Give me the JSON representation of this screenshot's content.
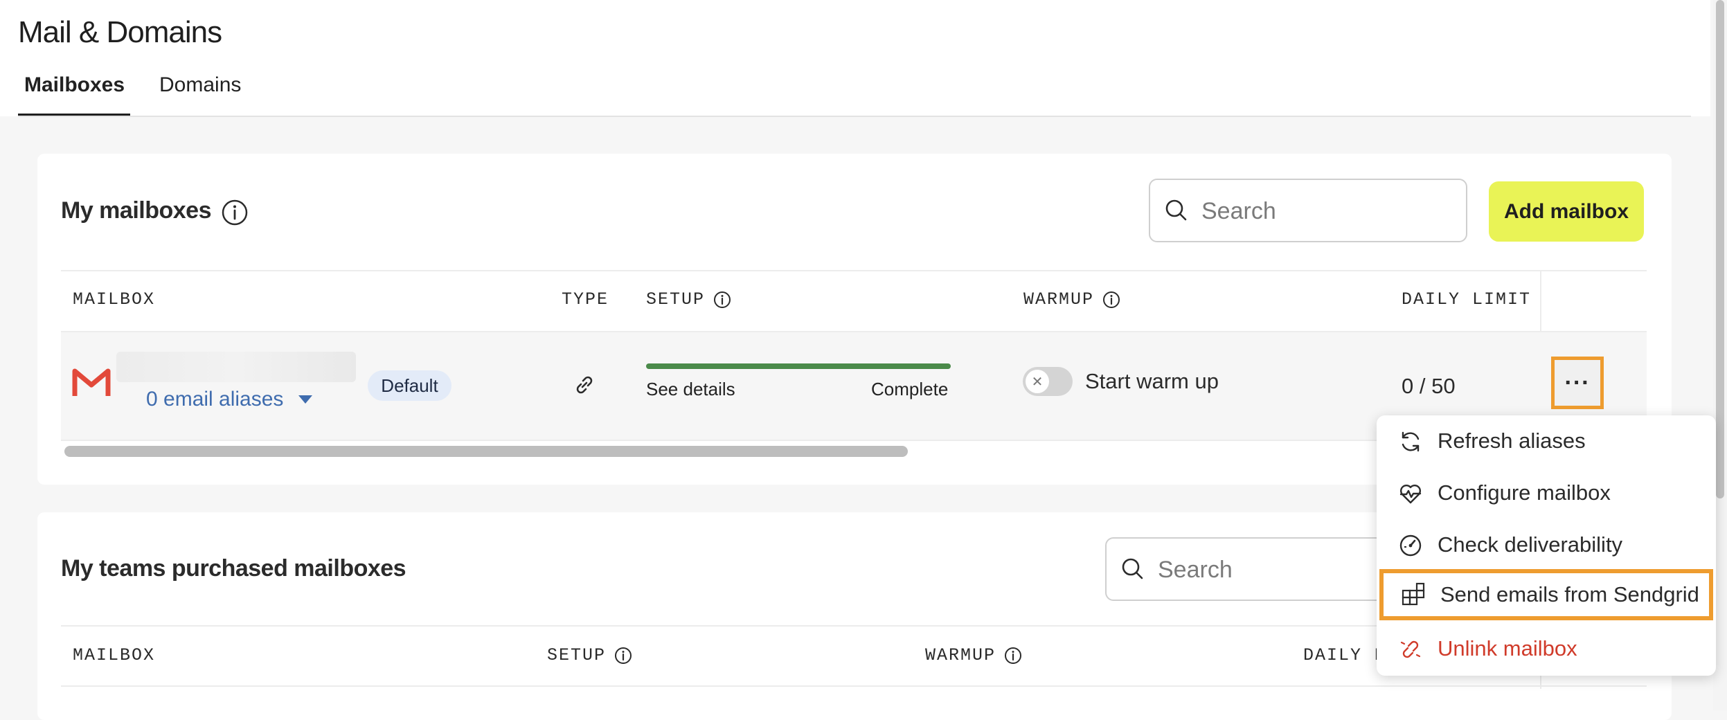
{
  "header": {
    "title": "Mail & Domains",
    "tabs": [
      {
        "label": "Mailboxes",
        "active": true
      },
      {
        "label": "Domains",
        "active": false
      }
    ]
  },
  "my_mailboxes": {
    "title": "My mailboxes",
    "search_placeholder": "Search",
    "add_button": "Add mailbox",
    "columns": {
      "mailbox": "MAILBOX",
      "type": "TYPE",
      "setup": "SETUP",
      "warmup": "WARMUP",
      "daily_limit": "DAILY LIMIT"
    },
    "row": {
      "provider_icon": "gmail-icon",
      "aliases_label": "0 email aliases",
      "default_badge": "Default",
      "type_icon": "link-icon",
      "setup_progress_percent": 100,
      "setup_link": "See details",
      "setup_status": "Complete",
      "warmup_enabled": false,
      "warmup_label": "Start warm up",
      "daily_limit": "0 / 50",
      "more_label": "···"
    }
  },
  "row_menu": {
    "items": [
      {
        "label": "Refresh aliases",
        "icon": "refresh-icon"
      },
      {
        "label": "Configure mailbox",
        "icon": "heart-pulse-icon"
      },
      {
        "label": "Check deliverability",
        "icon": "gauge-icon"
      },
      {
        "label": "Send emails from Sendgrid",
        "icon": "grid-icon",
        "highlighted": true
      },
      {
        "label": "Unlink mailbox",
        "icon": "unlink-icon",
        "danger": true
      }
    ]
  },
  "team_mailboxes": {
    "title": "My teams purchased mailboxes",
    "search_placeholder": "Search",
    "columns": {
      "mailbox": "MAILBOX",
      "setup": "SETUP",
      "warmup": "WARMUP",
      "daily_limit": "DAILY L"
    }
  },
  "colors": {
    "accent_button": "#e9f356",
    "highlight_border": "#ee9c2f",
    "progress_complete": "#4b8a4a",
    "link_blue": "#3f6cae",
    "danger_red": "#d03b2a",
    "gmail_red": "#e2493a"
  }
}
